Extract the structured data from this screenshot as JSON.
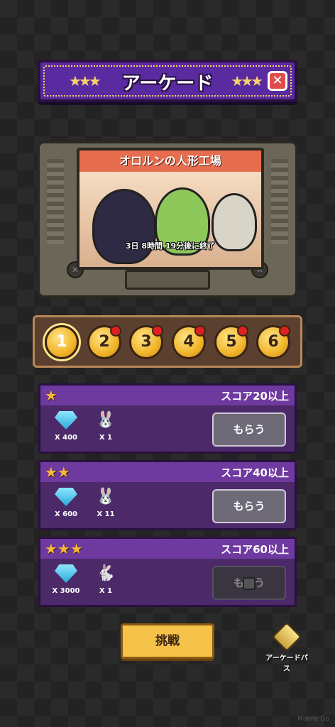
{
  "header": {
    "title": "アーケード",
    "stars": "★★★",
    "close_label": "✕"
  },
  "event": {
    "title": "オロルンの人形工場",
    "time_left": "3日 8時間 19分後に終了"
  },
  "levels": [
    {
      "label": "1",
      "active": true
    },
    {
      "label": "2",
      "active": false
    },
    {
      "label": "3",
      "active": false
    },
    {
      "label": "4",
      "active": false
    },
    {
      "label": "5",
      "active": false
    },
    {
      "label": "6",
      "active": false
    }
  ],
  "rewards": [
    {
      "stars": "★",
      "score": "スコア20以上",
      "gem_count": "X 400",
      "item_count": "X 1",
      "button": "もらう"
    },
    {
      "stars": "★★",
      "score": "スコア40以上",
      "gem_count": "X 600",
      "item_count": "X 11",
      "button": "もらう"
    },
    {
      "stars": "★★★",
      "score": "スコア60以上",
      "gem_count": "X 3000",
      "item_count": "X 1",
      "button_pre": "も",
      "button_post": "う"
    }
  ],
  "footer": {
    "challenge_label": "挑戦",
    "pass_label": "アーケードパス"
  },
  "watermark": "Mobile Go",
  "colors": {
    "accent_purple": "#5a2aa0",
    "gold": "#f5c24a",
    "red_dot": "#e02020"
  }
}
